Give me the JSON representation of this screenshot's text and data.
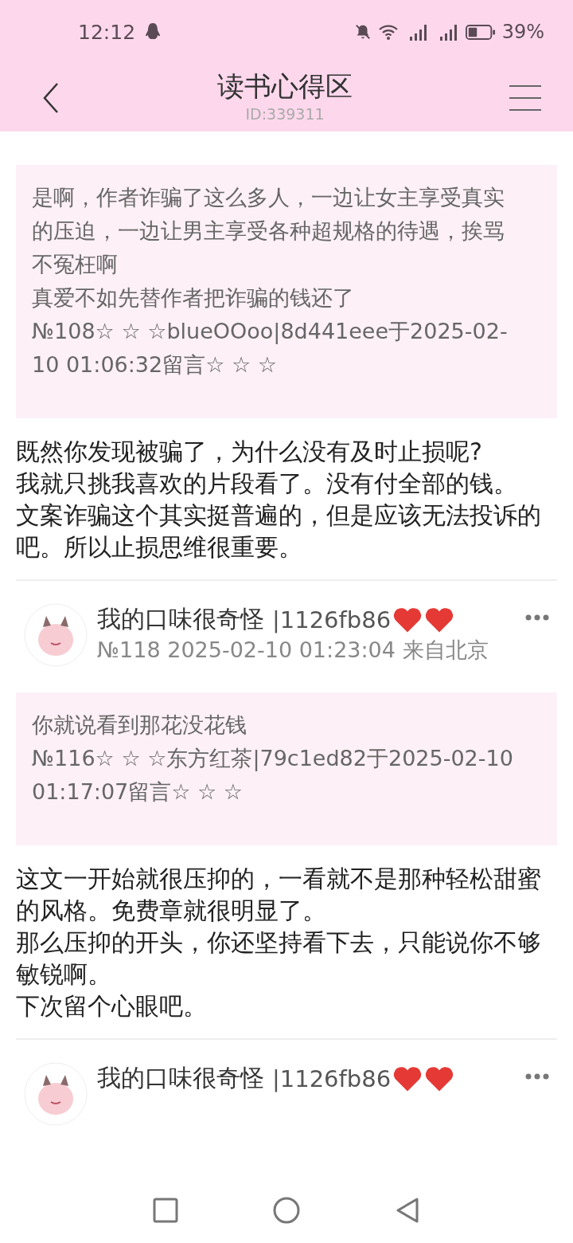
{
  "status_bar": {
    "time": "12:12",
    "battery": "39%"
  },
  "header": {
    "title": "读书心得区",
    "id": "ID:339311"
  },
  "posts": [
    {
      "quote": {
        "lines": [
          "是啊，作者诈骗了这么多人，一边让女主享受真实的压迫，一边让男主享受各种超规格的待遇，挨骂不冤枉啊",
          "真爱不如先替作者把诈骗的钱还了"
        ],
        "meta": "№108☆ ☆ ☆blueOOoo|8d441eee于2025-02-10 01:06:32留言☆ ☆ ☆"
      },
      "body": [
        "既然你发现被骗了，为什么没有及时止损呢?",
        "我就只挑我喜欢的片段看了。没有付全部的钱。",
        "文案诈骗这个其实挺普遍的，但是应该无法投诉的吧。所以止损思维很重要。"
      ]
    },
    {
      "author": "我的口味很奇怪",
      "tag": "|1126fb86",
      "meta": "№118 2025-02-10 01:23:04 来自北京",
      "quote": {
        "lines": [
          "你就说看到那花没花钱"
        ],
        "meta": "№116☆ ☆ ☆东方红茶|79c1ed82于2025-02-10 01:17:07留言☆ ☆ ☆"
      },
      "body": [
        "这文一开始就很压抑的，一看就不是那种轻松甜蜜的风格。免费章就很明显了。",
        "那么压抑的开头，你还坚持看下去，只能说你不够敏锐啊。",
        "下次留个心眼吧。"
      ]
    },
    {
      "author": "我的口味很奇怪",
      "tag": "|1126fb86"
    }
  ]
}
